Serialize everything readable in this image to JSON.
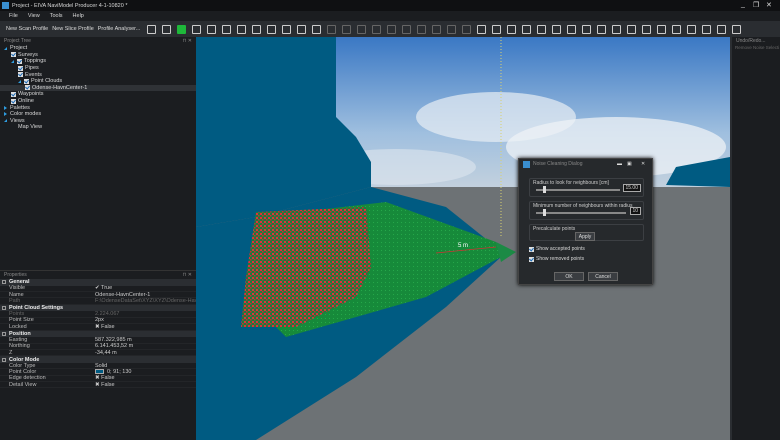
{
  "window": {
    "title": "Project - EIVA NaviModel Producer 4-1-10820  *",
    "controls": [
      "_",
      "❐",
      "✕"
    ]
  },
  "menu": [
    "File",
    "View",
    "Tools",
    "Help"
  ],
  "toolbar": {
    "buttons": [
      "New Scan Profile",
      "New Slice Profile",
      "Profile Analyser..."
    ],
    "icons": [
      "new-file-icon",
      "open-folder-icon",
      "save-icon",
      "plugin-icon",
      "view-2d-icon",
      "view-3d-icon",
      "grid-icon",
      "north-arrow-icon",
      "profile-icon",
      "ruler-icon",
      "camera-icon",
      "export-icon",
      "light-icon",
      "palette-icon",
      "brush-icon",
      "square-icon",
      "tag-icon",
      "points-icon",
      "smile-icon",
      "face-icon",
      "dot-icon",
      "dot-small-icon",
      "network-icon",
      "pin-icon",
      "frame-icon",
      "xyz-icon",
      "cloud-icon",
      "chart-icon",
      "point-icon",
      "dots-icon",
      "cloud-sync-icon",
      "cursor-icon",
      "cursor-select-icon",
      "polygon-icon",
      "cloud-x-icon",
      "cloud-check-icon",
      "cloud-remove-icon",
      "cloud-dot-icon",
      "cloud-undo-icon",
      "collapse-icon"
    ]
  },
  "project_tree": {
    "title": "Project Tree",
    "items": [
      {
        "label": "Project",
        "level": 0,
        "arrow": "open",
        "check": false
      },
      {
        "label": "Surveys",
        "level": 1,
        "arrow": "",
        "check": true
      },
      {
        "label": "Toppings",
        "level": 1,
        "arrow": "open",
        "check": true
      },
      {
        "label": "Pipes",
        "level": 2,
        "arrow": "",
        "check": true
      },
      {
        "label": "Events",
        "level": 2,
        "arrow": "",
        "check": true
      },
      {
        "label": "Point Clouds",
        "level": 2,
        "arrow": "open",
        "check": true
      },
      {
        "label": "Odense-HavnCenter-1",
        "level": 3,
        "arrow": "",
        "check": true,
        "selected": true
      },
      {
        "label": "Waypoints",
        "level": 1,
        "arrow": "",
        "check": true
      },
      {
        "label": "Online",
        "level": 1,
        "arrow": "",
        "check": true
      },
      {
        "label": "Palettes",
        "level": 0,
        "arrow": "closed",
        "check": false
      },
      {
        "label": "Color modes",
        "level": 0,
        "arrow": "closed",
        "check": false
      },
      {
        "label": "Views",
        "level": 0,
        "arrow": "open",
        "check": false
      },
      {
        "label": "Map View",
        "level": 2,
        "arrow": "",
        "check": false
      }
    ]
  },
  "properties": {
    "title": "Properties",
    "sections": [
      {
        "name": "General",
        "rows": [
          [
            "Visible",
            "✔  True",
            false
          ],
          [
            "Name",
            "Odense-HavnCenter-1",
            false
          ],
          [
            "Path",
            "F:\\OdenseDataSet\\XYZ\\XYZ\\Odense-HavnCenter",
            true
          ]
        ]
      },
      {
        "name": "Point Cloud Settings",
        "rows": [
          [
            "Points",
            "2.224.067",
            true
          ],
          [
            "Point Size",
            "2px",
            false
          ],
          [
            "Locked",
            "✖  False",
            false
          ]
        ]
      },
      {
        "name": "Position",
        "rows": [
          [
            "Easting",
            "587.322,985 m",
            false
          ],
          [
            "Northing",
            "6.141.453,52 m",
            false
          ],
          [
            "Z",
            "-34,44 m",
            false
          ]
        ]
      },
      {
        "name": "Color Mode",
        "rows": [
          [
            "Color Type",
            "Solid",
            false
          ],
          [
            "Point Color",
            "0; 91; 130",
            false
          ],
          [
            "Edge detection",
            "✖  False",
            false
          ],
          [
            "Detail View",
            "✖  False",
            false
          ]
        ]
      }
    ]
  },
  "colors": {
    "point_color": "#005b82",
    "accent": "#2f9de0"
  },
  "viewport": {
    "distance_label": "5 m"
  },
  "right_panel": {
    "title": "Undo/Redo...",
    "item": "Remove Noise Selecti"
  },
  "dialog": {
    "title": "Noise Cleaning Dialog",
    "radius_label": "Radius to look for neighbours [cm]",
    "radius_value": "15.00",
    "radius_fraction": 0.08,
    "min_label": "Minimum number of neighbours within radius",
    "min_value": "10",
    "min_fraction": 0.08,
    "precalc_label": "Precalculate points",
    "apply": "Apply",
    "show_accepted": "Show accepted points",
    "show_removed": "Show removed points",
    "ok": "OK",
    "cancel": "Cancel"
  }
}
